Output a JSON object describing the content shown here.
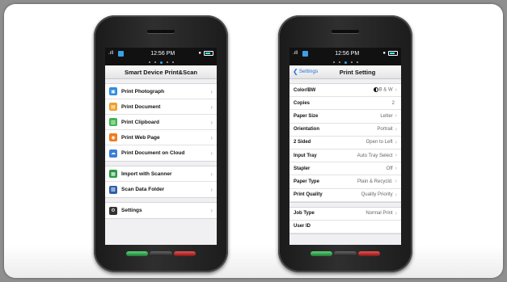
{
  "status": {
    "time": "12:56 PM",
    "signal": ".ıll"
  },
  "left": {
    "title": "Smart Device Print&Scan",
    "group1": [
      {
        "label": "Print Photograph",
        "icon": "photo-icon",
        "color": "#2e8ce0"
      },
      {
        "label": "Print Document",
        "icon": "document-icon",
        "color": "#f0a02a"
      },
      {
        "label": "Print Clipboard",
        "icon": "clipboard-icon",
        "color": "#3fb552"
      },
      {
        "label": "Print Web Page",
        "icon": "web-page-icon",
        "color": "#f07a1a"
      },
      {
        "label": "Print Document on Cloud",
        "icon": "cloud-icon",
        "color": "#3a7fd6"
      }
    ],
    "group2": [
      {
        "label": "Import with Scanner",
        "icon": "scanner-icon",
        "color": "#2a9a48"
      },
      {
        "label": "Scan Data Folder",
        "icon": "folder-icon",
        "color": "#2e5ea8"
      }
    ],
    "group3": [
      {
        "label": "Settings",
        "icon": "gear-icon",
        "color": "#333333"
      }
    ]
  },
  "right": {
    "back_label": "Settings",
    "title": "Print Setting",
    "group1": [
      {
        "label": "Color/BW",
        "value": "B & W"
      },
      {
        "label": "Copies",
        "value": "2"
      },
      {
        "label": "Paper Size",
        "value": "Letter"
      },
      {
        "label": "Orientation",
        "value": "Portrait"
      },
      {
        "label": "2 Sided",
        "value": "Open to Left"
      },
      {
        "label": "Input Tray",
        "value": "Auto Tray Select"
      },
      {
        "label": "Stapler",
        "value": "Off"
      },
      {
        "label": "Paper Type",
        "value": "Plain & Recycld."
      },
      {
        "label": "Print Quality",
        "value": "Quality Priority"
      }
    ],
    "group2": [
      {
        "label": "Job Type",
        "value": "Normal Print"
      },
      {
        "label": "User ID",
        "value": ""
      }
    ]
  }
}
